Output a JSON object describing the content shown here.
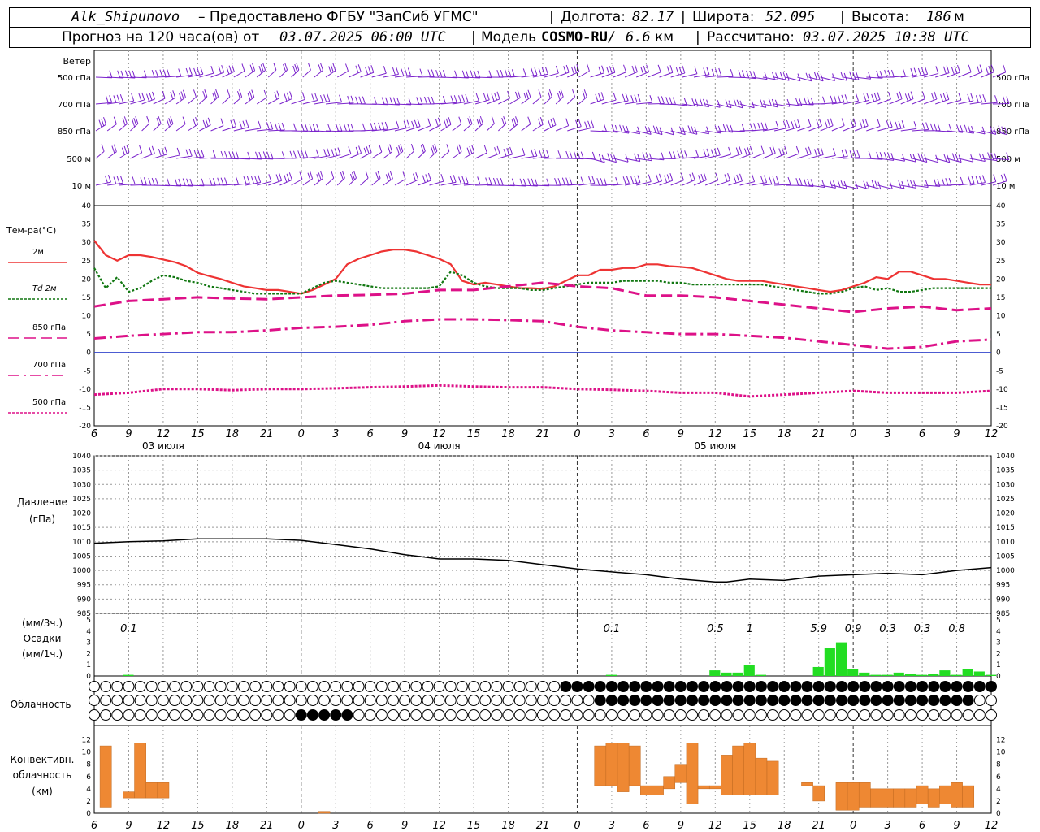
{
  "header": {
    "station": "Alk_Shipunovo",
    "provider": "– Предоставлено ФГБУ \"ЗапСиб УГМС\"",
    "lon_label": "Долгота:",
    "lon": "82.17",
    "lat_label": "Широта:",
    "lat": "52.095",
    "alt_label": "Высота:",
    "alt": "186",
    "alt_unit": "м",
    "forecast_label": "Прогноз на 120 часа(ов) от",
    "forecast_from": "03.07.2025 06:00 UTC",
    "model_label": "Модель",
    "model": "COSMO-RU",
    "resolution": "6.6",
    "resolution_unit": "км",
    "computed_label": "Рассчитано:",
    "computed": "03.07.2025 10:38 UTC"
  },
  "panels": {
    "wind": {
      "title": "Ветер",
      "levels": [
        "500 гПа",
        "700 гПа",
        "850 гПа",
        "500 м",
        "10 м"
      ]
    },
    "temp": {
      "title": "Тем-ра(°C)",
      "legend": [
        {
          "label": "2м",
          "color": "#ee3333",
          "style": "solid"
        },
        {
          "label": "Td 2м",
          "color": "#117711",
          "style": "dotted"
        },
        {
          "label": "850 гПа",
          "color": "#dd1188",
          "style": "dash"
        },
        {
          "label": "700 гПа",
          "color": "#dd1188",
          "style": "dashdot"
        },
        {
          "label": "500 гПа",
          "color": "#dd1188",
          "style": "dotted"
        }
      ],
      "ticks": [
        "40",
        "35",
        "30",
        "25",
        "20",
        "15",
        "10",
        "5",
        "0",
        "-5",
        "-10",
        "-15",
        "-20"
      ]
    },
    "pressure": {
      "title": "Давление",
      "unit": "(гПа)",
      "ticks": [
        "1040",
        "1035",
        "1030",
        "1025",
        "1020",
        "1015",
        "1010",
        "1005",
        "1000",
        "995",
        "990",
        "985"
      ]
    },
    "precip": {
      "unit_3h": "(мм/3ч.)",
      "title": "Осадки",
      "unit_1h": "(мм/1ч.)",
      "ticks": [
        "5",
        "4",
        "3",
        "2",
        "1",
        "0"
      ],
      "totals_3h": [
        {
          "hour": 9,
          "label": "0.1"
        },
        {
          "hour": 51,
          "label": "0.1"
        },
        {
          "hour": 60,
          "label": "0.5"
        },
        {
          "hour": 63,
          "label": "1"
        },
        {
          "hour": 69,
          "label": "5.9"
        },
        {
          "hour": 72,
          "label": "0.9"
        },
        {
          "hour": 75,
          "label": "0.3"
        },
        {
          "hour": 78,
          "label": "0.3"
        },
        {
          "hour": 81,
          "label": "0.8"
        }
      ]
    },
    "clouds": {
      "title": "Облачность"
    },
    "convective": {
      "title_1": "Конвективн.",
      "title_2": "облачность",
      "unit": "(км)",
      "ticks": [
        "12",
        "10",
        "8",
        "6",
        "4",
        "2",
        "0"
      ]
    }
  },
  "time_axis": {
    "hour_labels": [
      "6",
      "9",
      "12",
      "15",
      "18",
      "21",
      "0",
      "3",
      "6",
      "9",
      "12",
      "15",
      "18",
      "21",
      "0",
      "3",
      "6",
      "9",
      "12",
      "15",
      "18",
      "21",
      "0",
      "3",
      "6",
      "9",
      "12"
    ],
    "day_labels": [
      {
        "hour": 12,
        "label": "03 июля"
      },
      {
        "hour": 36,
        "label": "04 июля"
      },
      {
        "hour": 60,
        "label": "05 июля"
      }
    ]
  },
  "colors": {
    "wind": "#7a22cc",
    "t2m": "#ee3333",
    "td2m": "#117711",
    "t850": "#dd1188",
    "t700": "#dd1188",
    "t500": "#dd1188",
    "zero_line": "#3344cc",
    "pressure": "#000000",
    "precip": "#22dd22",
    "convective": "#ee8833",
    "grid": "#999999"
  },
  "chart_data": [
    {
      "type": "line",
      "name_ref": "temperature",
      "x_unit": "hours since 03.07.2025 00:00 UTC",
      "ylim": [
        -20,
        40
      ],
      "series": [
        {
          "name": "2м",
          "x": [
            6,
            7,
            8,
            9,
            10,
            11,
            12,
            13,
            14,
            15,
            16,
            17,
            18,
            19,
            20,
            21,
            22,
            23,
            24,
            25,
            26,
            27,
            28,
            29,
            30,
            31,
            32,
            33,
            34,
            35,
            36,
            37,
            38,
            39,
            40,
            41,
            42,
            43,
            44,
            45,
            46,
            47,
            48,
            49,
            50,
            51,
            52,
            53,
            54,
            55,
            56,
            57,
            58,
            59,
            60,
            61,
            62,
            63,
            64,
            65,
            66,
            67,
            68,
            69,
            70,
            71,
            72,
            73,
            74,
            75,
            76,
            77,
            78,
            79,
            80,
            81,
            82,
            83,
            84
          ],
          "y": [
            30.5,
            26.5,
            25,
            26.5,
            26.5,
            26,
            25.3,
            24.6,
            23.5,
            21.7,
            20.8,
            20,
            19,
            18,
            17.5,
            17,
            17,
            16.5,
            16,
            17,
            18.5,
            20,
            24,
            25.5,
            26.5,
            27.5,
            28,
            28,
            27.5,
            26.5,
            25.5,
            24,
            19.5,
            18.5,
            19,
            18.5,
            18,
            17.5,
            17.5,
            17.3,
            18,
            19.5,
            21,
            21,
            22.5,
            22.5,
            23,
            23,
            24,
            24,
            23.5,
            23.3,
            23,
            22,
            21,
            20,
            19.5,
            19.5,
            19.5,
            19,
            18.5,
            18,
            17.5,
            17,
            16.5,
            17,
            18,
            19,
            20.5,
            20,
            22,
            22,
            21,
            20,
            20,
            19.5,
            19,
            18.5,
            18.5
          ]
        },
        {
          "name": "Td 2м",
          "x": [
            6,
            7,
            8,
            9,
            10,
            11,
            12,
            13,
            14,
            15,
            16,
            17,
            18,
            19,
            20,
            21,
            22,
            23,
            24,
            25,
            26,
            27,
            28,
            29,
            30,
            31,
            32,
            33,
            34,
            35,
            36,
            37,
            38,
            39,
            40,
            41,
            42,
            43,
            44,
            45,
            46,
            47,
            48,
            49,
            50,
            51,
            52,
            53,
            54,
            55,
            56,
            57,
            58,
            59,
            60,
            61,
            62,
            63,
            64,
            65,
            66,
            67,
            68,
            69,
            70,
            71,
            72,
            73,
            74,
            75,
            76,
            77,
            78,
            79,
            80,
            81,
            82,
            83,
            84
          ],
          "y": [
            23,
            17.5,
            20.5,
            16.5,
            17.5,
            19.5,
            21,
            20.5,
            19.5,
            19,
            18,
            17.5,
            17,
            16.5,
            16,
            16,
            16,
            16,
            16,
            17.5,
            19,
            19.5,
            19,
            18.5,
            18,
            17.5,
            17.5,
            17.5,
            17.5,
            17.5,
            18,
            22,
            21,
            19,
            18,
            17.5,
            17.5,
            17.5,
            17,
            17,
            17.5,
            18,
            18.5,
            19,
            19,
            19,
            19.5,
            19.5,
            19.5,
            19.5,
            19,
            19,
            18.5,
            18.5,
            18.5,
            18.5,
            18.5,
            18.5,
            18.5,
            18,
            17.5,
            17,
            16.5,
            16,
            16,
            16.5,
            17.5,
            18,
            17,
            17.5,
            16.5,
            16.5,
            17,
            17.5,
            17.5,
            17.5,
            17.5,
            17.5,
            17.5
          ]
        },
        {
          "name": "850 гПа",
          "x": [
            6,
            9,
            12,
            15,
            18,
            21,
            24,
            27,
            30,
            33,
            36,
            39,
            42,
            45,
            48,
            51,
            54,
            57,
            60,
            63,
            66,
            69,
            72,
            75,
            78,
            81,
            84
          ],
          "y": [
            12.5,
            14,
            14.5,
            15,
            14.7,
            14.5,
            15,
            15.5,
            15.7,
            16,
            17,
            17,
            18,
            19,
            18,
            17.5,
            15.5,
            15.5,
            15,
            14,
            13,
            12,
            11,
            12,
            12.5,
            11.5,
            12
          ]
        },
        {
          "name": "700 гПа",
          "x": [
            6,
            9,
            12,
            15,
            18,
            21,
            24,
            27,
            30,
            33,
            36,
            39,
            42,
            45,
            48,
            51,
            54,
            57,
            60,
            63,
            66,
            69,
            72,
            75,
            78,
            81,
            84
          ],
          "y": [
            3.8,
            4.5,
            5,
            5.5,
            5.5,
            6,
            6.7,
            7,
            7.5,
            8.5,
            9,
            9,
            8.8,
            8.5,
            7,
            6,
            5.5,
            5,
            5,
            4.5,
            4,
            3,
            2,
            1,
            1.5,
            3,
            3.5
          ]
        },
        {
          "name": "500 гПа",
          "x": [
            6,
            9,
            12,
            15,
            18,
            21,
            24,
            27,
            30,
            33,
            36,
            39,
            42,
            45,
            48,
            51,
            54,
            57,
            60,
            63,
            66,
            69,
            72,
            75,
            78,
            81,
            84
          ],
          "y": [
            -11.5,
            -11,
            -10,
            -10,
            -10.3,
            -10,
            -10,
            -9.8,
            -9.5,
            -9.3,
            -9,
            -9.3,
            -9.5,
            -9.5,
            -10,
            -10.2,
            -10.5,
            -11,
            -11,
            -12,
            -11.5,
            -11,
            -10.5,
            -11,
            -11,
            -11,
            -10.5
          ]
        }
      ]
    },
    {
      "type": "line",
      "name_ref": "pressure",
      "ylim": [
        985,
        1040
      ],
      "series": [
        {
          "name": "",
          "x": [
            6,
            9,
            12,
            15,
            18,
            21,
            24,
            27,
            30,
            33,
            36,
            39,
            42,
            45,
            48,
            51,
            54,
            57,
            60,
            61,
            63,
            66,
            69,
            72,
            75,
            78,
            81,
            84
          ],
          "y": [
            1009.5,
            1010,
            1010.3,
            1011,
            1011,
            1011,
            1010.5,
            1009,
            1007.5,
            1005.5,
            1004,
            1004,
            1003.5,
            1002,
            1000.5,
            999.5,
            998.5,
            997,
            996,
            996,
            997,
            996.5,
            998,
            998.5,
            999,
            998.5,
            1000,
            1001
          ]
        }
      ]
    },
    {
      "type": "bar",
      "name_ref": "precipitation_1h",
      "ylim": [
        0,
        5
      ],
      "x": [
        9,
        51,
        60,
        61,
        62,
        63,
        64,
        69,
        70,
        71,
        72,
        73,
        74,
        75,
        76,
        77,
        78,
        79,
        80,
        81,
        82,
        83,
        84
      ],
      "values": [
        0.1,
        0.1,
        0.5,
        0.3,
        0.3,
        1,
        0.1,
        0.8,
        2.5,
        3,
        0.6,
        0.3,
        0.1,
        0.1,
        0.3,
        0.2,
        0.1,
        0.2,
        0.5,
        0.1,
        0.6,
        0.4,
        0.1
      ]
    },
    {
      "type": "bar",
      "name_ref": "convective_clouds",
      "ylim": [
        0,
        13
      ],
      "ranges_km": [
        {
          "x": 7,
          "base": 1,
          "top": 11
        },
        {
          "x": 9,
          "base": 2.5,
          "top": 3.5
        },
        {
          "x": 10,
          "base": 2.5,
          "top": 11.5
        },
        {
          "x": 11,
          "base": 2.5,
          "top": 5
        },
        {
          "x": 12,
          "base": 2.5,
          "top": 5
        },
        {
          "x": 26,
          "base": 0,
          "top": 0.3
        },
        {
          "x": 50,
          "base": 4.5,
          "top": 11
        },
        {
          "x": 51,
          "base": 4.5,
          "top": 11.5
        },
        {
          "x": 52,
          "base": 3.5,
          "top": 11.5
        },
        {
          "x": 53,
          "base": 4.5,
          "top": 11
        },
        {
          "x": 54,
          "base": 3,
          "top": 4.5
        },
        {
          "x": 55,
          "base": 3,
          "top": 4.5
        },
        {
          "x": 56,
          "base": 4,
          "top": 6
        },
        {
          "x": 57,
          "base": 5,
          "top": 8
        },
        {
          "x": 58,
          "base": 1.5,
          "top": 11.5
        },
        {
          "x": 59,
          "base": 4,
          "top": 4.5
        },
        {
          "x": 60,
          "base": 4,
          "top": 4.5
        },
        {
          "x": 61,
          "base": 3,
          "top": 9.5
        },
        {
          "x": 62,
          "base": 3,
          "top": 11
        },
        {
          "x": 63,
          "base": 3,
          "top": 11.5
        },
        {
          "x": 64,
          "base": 3,
          "top": 9
        },
        {
          "x": 65,
          "base": 3,
          "top": 8.5
        },
        {
          "x": 68,
          "base": 4.5,
          "top": 5
        },
        {
          "x": 69,
          "base": 2,
          "top": 4.5
        },
        {
          "x": 71,
          "base": 0.5,
          "top": 5
        },
        {
          "x": 72,
          "base": 0.5,
          "top": 5
        },
        {
          "x": 73,
          "base": 1,
          "top": 5
        },
        {
          "x": 74,
          "base": 1,
          "top": 4
        },
        {
          "x": 75,
          "base": 1,
          "top": 4
        },
        {
          "x": 76,
          "base": 1,
          "top": 4
        },
        {
          "x": 77,
          "base": 1,
          "top": 4
        },
        {
          "x": 78,
          "base": 1.5,
          "top": 4.5
        },
        {
          "x": 79,
          "base": 1,
          "top": 4
        },
        {
          "x": 80,
          "base": 1.5,
          "top": 4.5
        },
        {
          "x": 81,
          "base": 1,
          "top": 5
        },
        {
          "x": 82,
          "base": 1,
          "top": 4.5
        }
      ]
    }
  ]
}
